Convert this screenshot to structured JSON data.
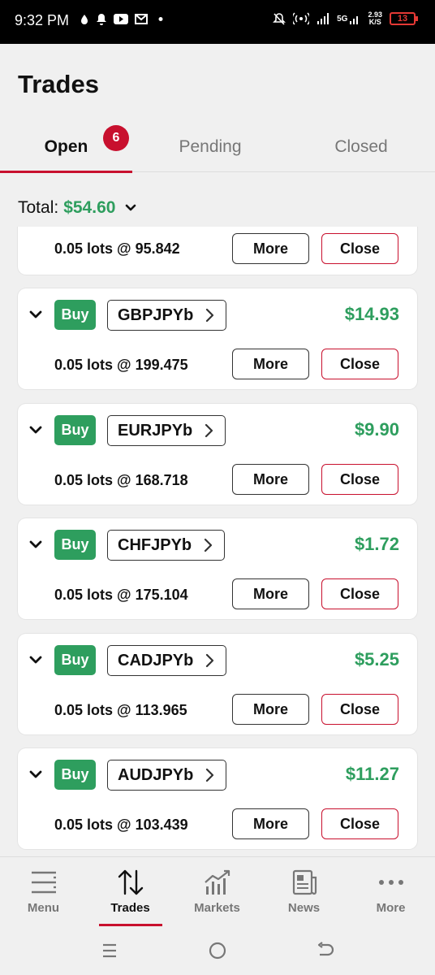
{
  "status_bar": {
    "time": "9:32 PM",
    "network": "5G",
    "net_speed_value": "2.93",
    "net_speed_unit": "K/S",
    "battery": "13"
  },
  "header": {
    "title": "Trades"
  },
  "tabs": [
    {
      "label": "Open",
      "badge": "6",
      "active": true
    },
    {
      "label": "Pending",
      "active": false
    },
    {
      "label": "Closed",
      "active": false
    }
  ],
  "total": {
    "label": "Total:",
    "value": "$54.60"
  },
  "first_trade_partial": {
    "lots": "0.05 lots @ 95.842"
  },
  "trades": [
    {
      "side": "Buy",
      "symbol": "GBPJPYb",
      "pnl": "$14.93",
      "lots": "0.05 lots @ 199.475"
    },
    {
      "side": "Buy",
      "symbol": "EURJPYb",
      "pnl": "$9.90",
      "lots": "0.05 lots @ 168.718"
    },
    {
      "side": "Buy",
      "symbol": "CHFJPYb",
      "pnl": "$1.72",
      "lots": "0.05 lots @ 175.104"
    },
    {
      "side": "Buy",
      "symbol": "CADJPYb",
      "pnl": "$5.25",
      "lots": "0.05 lots @ 113.965"
    },
    {
      "side": "Buy",
      "symbol": "AUDJPYb",
      "pnl": "$11.27",
      "lots": "0.05 lots @ 103.439"
    }
  ],
  "buttons": {
    "more": "More",
    "close": "Close"
  },
  "bottom_nav": [
    {
      "label": "Menu",
      "icon": "menu-icon"
    },
    {
      "label": "Trades",
      "icon": "trades-icon",
      "active": true
    },
    {
      "label": "Markets",
      "icon": "markets-icon"
    },
    {
      "label": "News",
      "icon": "news-icon"
    },
    {
      "label": "More",
      "icon": "more-dots-icon"
    }
  ],
  "colors": {
    "accent_red": "#c8102e",
    "profit_green": "#2e9e5e",
    "background": "#f0f0f0"
  }
}
